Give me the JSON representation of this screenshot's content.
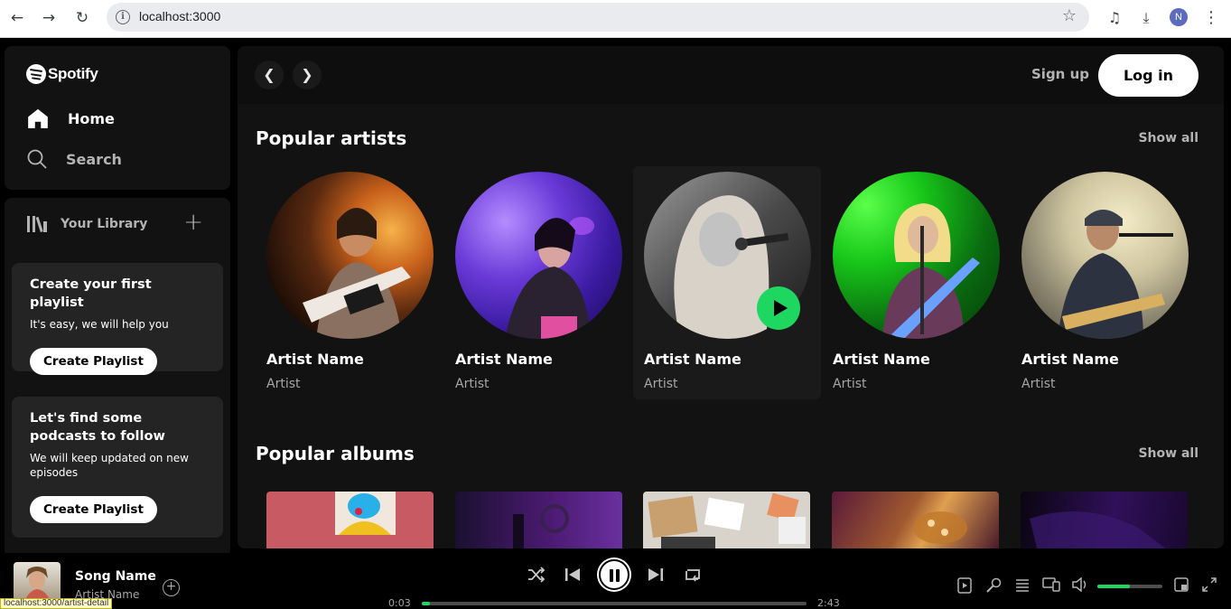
{
  "browser": {
    "url": "localhost:3000",
    "profile_initial": "N",
    "status_link": "localhost:3000/artist-detail"
  },
  "sidebar": {
    "brand": "Spotify",
    "nav": [
      {
        "label": "Home",
        "icon": "home-icon"
      },
      {
        "label": "Search",
        "icon": "search-icon"
      }
    ],
    "library": {
      "label": "Your Library",
      "cards": [
        {
          "title": "Create your first playlist",
          "text": "It's easy, we will help you",
          "button": "Create Playlist"
        },
        {
          "title": "Let's find some podcasts to follow",
          "text": "We will keep updated on new episodes",
          "button": "Create Playlist"
        }
      ]
    }
  },
  "header": {
    "signup": "Sign up",
    "login": "Log in"
  },
  "sections": {
    "artists": {
      "title": "Popular artists",
      "show_all": "Show all",
      "items": [
        {
          "name": "Artist Name",
          "type": "Artist"
        },
        {
          "name": "Artist Name",
          "type": "Artist"
        },
        {
          "name": "Artist Name",
          "type": "Artist"
        },
        {
          "name": "Artist Name",
          "type": "Artist"
        },
        {
          "name": "Artist Name",
          "type": "Artist"
        }
      ]
    },
    "albums": {
      "title": "Popular albums",
      "show_all": "Show all"
    }
  },
  "player": {
    "song": "Song Name",
    "artist": "Artist Name",
    "elapsed": "0:03",
    "duration": "2:43",
    "progress": 0.02,
    "volume": 0.5
  },
  "colors": {
    "accent": "#1ed760",
    "background": "#121212",
    "card": "#242424"
  }
}
